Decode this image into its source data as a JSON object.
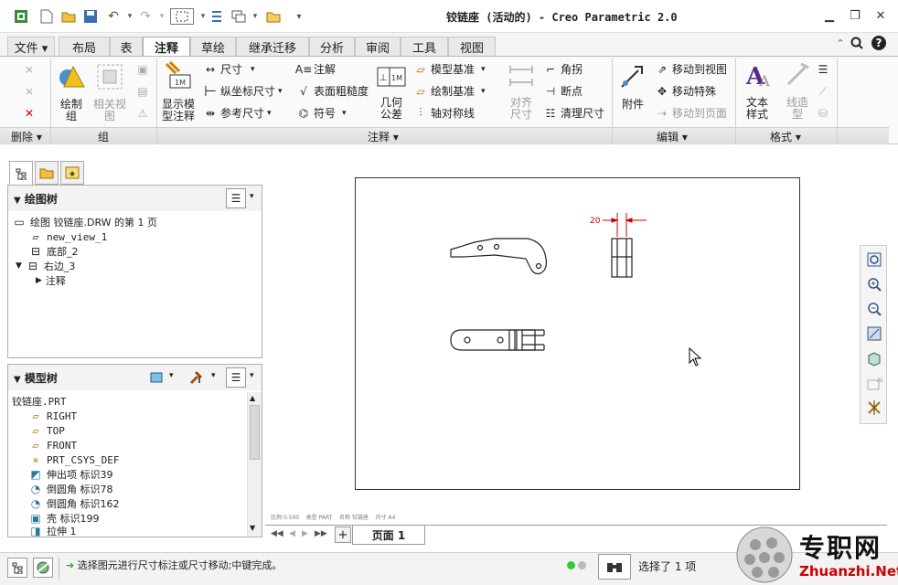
{
  "window": {
    "title": "铰链座 (活动的) - Creo Parametric 2.0"
  },
  "tabs": [
    {
      "label": "文件 ▾"
    },
    {
      "label": "布局"
    },
    {
      "label": "表"
    },
    {
      "label": "注释"
    },
    {
      "label": "草绘"
    },
    {
      "label": "继承迁移"
    },
    {
      "label": "分析"
    },
    {
      "label": "审阅"
    },
    {
      "label": "工具"
    },
    {
      "label": "视图"
    }
  ],
  "active_tab": "注释",
  "ribbon": {
    "delete_group": "删除 ▾",
    "group_group": "组",
    "annotation_group": "注释 ▾",
    "edit_group": "编辑 ▾",
    "format_group": "格式 ▾",
    "draw_group_line1": "绘制",
    "draw_group_line2": "组",
    "related_view_line1": "相关视",
    "related_view_line2": "图",
    "show_model_line1": "显示模",
    "show_model_line2": "型注释",
    "dimension": "尺寸",
    "ordinate_dimension": "纵坐标尺寸",
    "reference_dimension": "参考尺寸",
    "note": "注解",
    "surface_finish": "表面粗糙度",
    "symbol": "符号",
    "gtol_line1": "几何",
    "gtol_line2": "公差",
    "model_datum": "模型基准",
    "draft_datum": "绘制基准",
    "axis_symmetry": "轴对称线",
    "align_line1": "对齐",
    "align_line2": "尺寸",
    "jog": "角拐",
    "breakpoint": "断点",
    "cleanup_dims": "清理尺寸",
    "attachment": "附件",
    "move_to_view": "移动到视图",
    "move_special": "移动特殊",
    "move_to_page": "移动到页面",
    "text_style_line1": "文本",
    "text_style_line2": "样式",
    "line_style_line1": "线造",
    "line_style_line2": "型"
  },
  "drawing_tree": {
    "title": "绘图树",
    "items": [
      {
        "label": "绘图 铰链座.DRW 的第 1 页"
      },
      {
        "label": "new_view_1"
      },
      {
        "label": "底部_2"
      },
      {
        "label": "右边_3"
      },
      {
        "label": "注释"
      }
    ]
  },
  "model_tree": {
    "title": "模型树",
    "root": "铰链座.PRT",
    "items": [
      {
        "label": "RIGHT"
      },
      {
        "label": "TOP"
      },
      {
        "label": "FRONT"
      },
      {
        "label": "PRT_CSYS_DEF"
      },
      {
        "label": "伸出项 标识39"
      },
      {
        "label": "倒圆角 标识78"
      },
      {
        "label": "倒圆角 标识162"
      },
      {
        "label": "壳 标识199"
      },
      {
        "label": "拉伸 1"
      }
    ]
  },
  "drawing": {
    "dimension_value": "20"
  },
  "sheet_info": {
    "scale": "比例 0.500",
    "type": "类型 PART",
    "name": "名称 铰链座",
    "size": "尺寸 A4"
  },
  "page_tab": "页面 1",
  "status": {
    "message": "选择图元进行尺寸标注或尺寸移动;中键完成。",
    "selection": "选择了 1 项"
  },
  "watermark": {
    "cn": "专职网",
    "en": "Zhuanzhi.Net"
  },
  "colors": {
    "accent_red": "#cc0000",
    "ribbon_bg": "#fafafa",
    "status_green": "#3c3"
  }
}
